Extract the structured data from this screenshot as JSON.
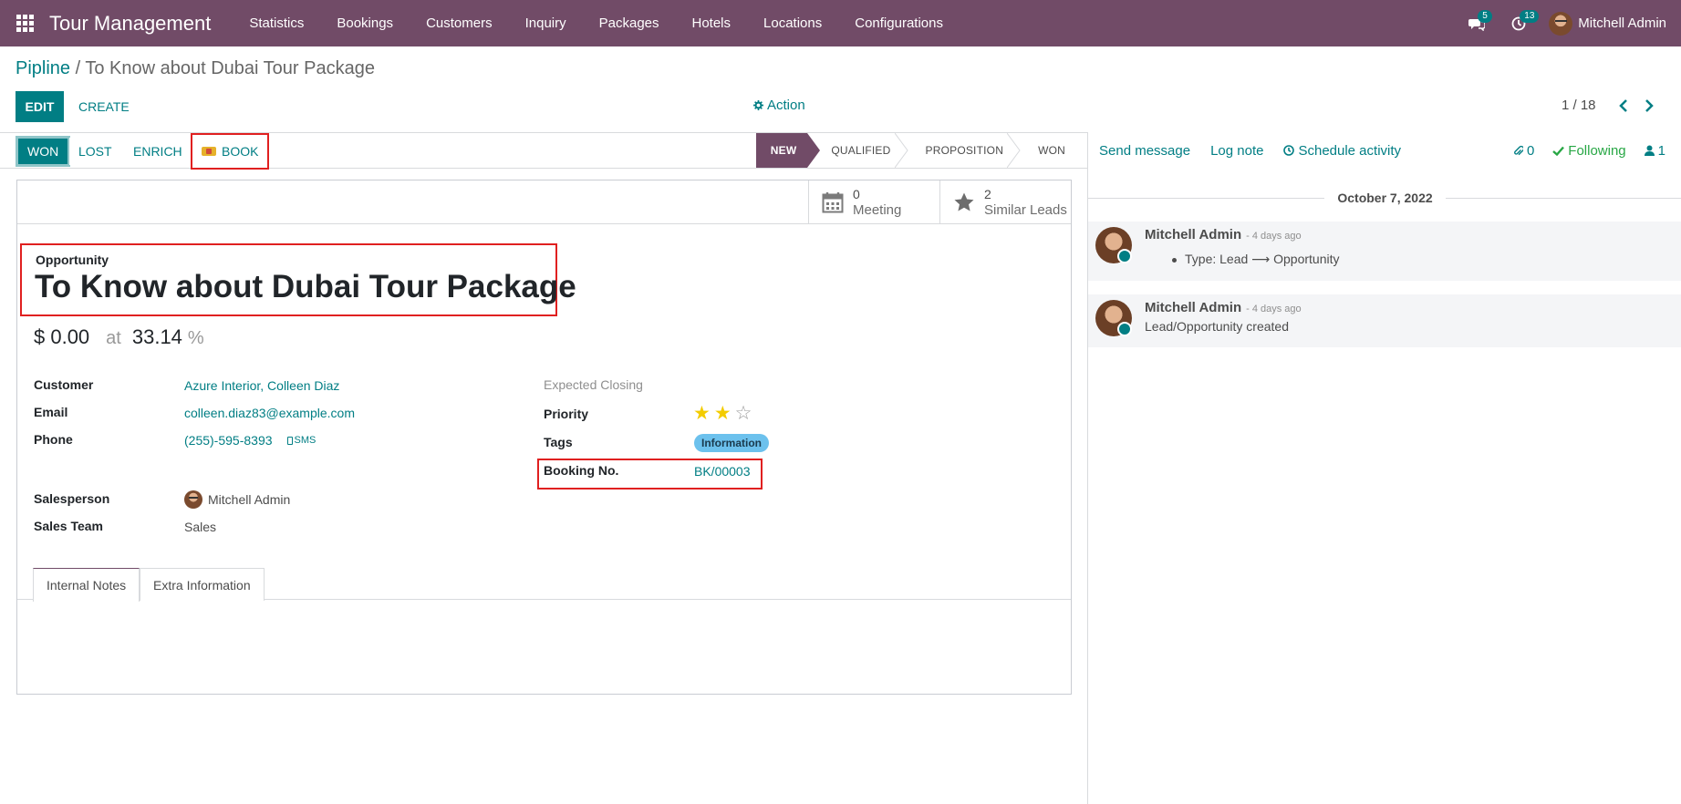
{
  "navbar": {
    "brand": "Tour Management",
    "menu": [
      "Statistics",
      "Bookings",
      "Customers",
      "Inquiry",
      "Packages",
      "Hotels",
      "Locations",
      "Configurations"
    ],
    "messages_count": "5",
    "activities_count": "13",
    "user_name": "Mitchell Admin"
  },
  "control_panel": {
    "breadcrumb_parent": "Pipline",
    "breadcrumb_sep": " / ",
    "breadcrumb_current": "To Know about Dubai Tour Package",
    "edit_label": "EDIT",
    "create_label": "CREATE",
    "action_label": "Action",
    "pager": "1 / 18"
  },
  "statusbar": {
    "won_label": "WON",
    "lost_label": "LOST",
    "enrich_label": "ENRICH",
    "book_label": "BOOK",
    "stages": [
      "NEW",
      "QUALIFIED",
      "PROPOSITION",
      "WON"
    ],
    "active_stage": "NEW"
  },
  "smart_buttons": {
    "meeting_value": "0",
    "meeting_label": "Meeting",
    "leads_value": "2",
    "leads_label": "Similar Leads"
  },
  "form": {
    "type_label": "Opportunity",
    "name": "To Know about Dubai Tour Package",
    "expected_revenue": "$ 0.00",
    "at_label": "at",
    "probability": "33.14",
    "percent_sign": "%",
    "customer_label": "Customer",
    "customer_value": "Azure Interior, Colleen Diaz",
    "email_label": "Email",
    "email_value": "colleen.diaz83@example.com",
    "phone_label": "Phone",
    "phone_value": "(255)-595-8393",
    "sms_label": "SMS",
    "salesperson_label": "Salesperson",
    "salesperson_value": "Mitchell Admin",
    "sales_team_label": "Sales Team",
    "sales_team_value": "Sales",
    "expected_closing_label": "Expected Closing",
    "priority_label": "Priority",
    "priority_stars": 2,
    "priority_max": 3,
    "tags_label": "Tags",
    "tag_value": "Information",
    "booking_label": "Booking No.",
    "booking_value": "BK/00003",
    "tabs": [
      "Internal Notes",
      "Extra Information"
    ]
  },
  "chatter": {
    "send_message": "Send message",
    "log_note": "Log note",
    "schedule_activity": "Schedule activity",
    "attachments_count": "0",
    "following_label": "Following",
    "followers_count": "1",
    "date_separator": "October 7, 2022",
    "messages": [
      {
        "author": "Mitchell Admin",
        "date": "- 4 days ago",
        "body": "Type: Lead ⟶ Opportunity"
      },
      {
        "author": "Mitchell Admin",
        "date": "- 4 days ago",
        "body": "Lead/Opportunity created"
      }
    ]
  },
  "colors": {
    "brand_purple": "#714b67",
    "accent_teal": "#017e84",
    "highlight_red": "#e02020",
    "star_yellow": "#f3cc00",
    "tag_blue": "#6cc1ed"
  }
}
